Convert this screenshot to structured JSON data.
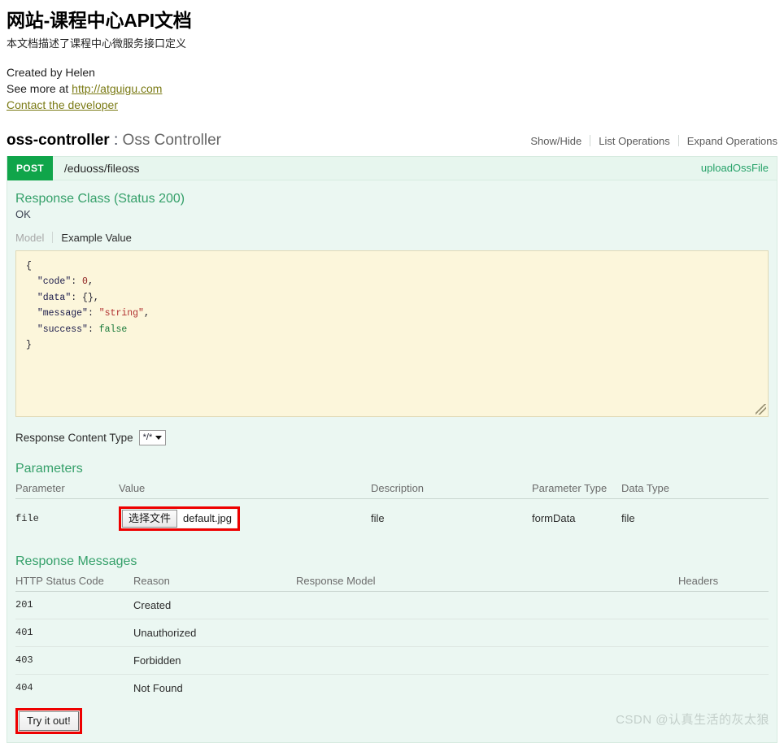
{
  "info": {
    "title": "网站-课程中心API文档",
    "description": "本文档描述了课程中心微服务接口定义",
    "created_by": "Created by Helen",
    "see_more_prefix": "See more at ",
    "see_more_link": "http://atguigu.com",
    "contact_link": "Contact the developer"
  },
  "resource": {
    "name": "oss-controller",
    "separator": " : ",
    "display_name": "Oss Controller",
    "actions": {
      "show_hide": "Show/Hide",
      "list_operations": "List Operations",
      "expand_operations": "Expand Operations"
    }
  },
  "operation": {
    "method": "POST",
    "path": "/eduoss/fileoss",
    "summary": "uploadOssFile",
    "response_class_title": "Response Class (Status 200)",
    "response_class_status": "OK",
    "tabs": {
      "model": "Model",
      "example_value": "Example Value"
    },
    "example_value": {
      "line_open": "{",
      "code_key": "\"code\"",
      "code_value": "0",
      "data_key": "\"data\"",
      "data_value": "{}",
      "message_key": "\"message\"",
      "message_value": "\"string\"",
      "success_key": "\"success\"",
      "success_value": "false",
      "line_close": "}"
    },
    "response_content_type_label": "Response Content Type",
    "response_content_type_value": "*/*"
  },
  "parameters": {
    "title": "Parameters",
    "headers": [
      "Parameter",
      "Value",
      "Description",
      "Parameter Type",
      "Data Type"
    ],
    "rows": [
      {
        "parameter": "file",
        "value_button": "选择文件",
        "value_filename": "default.jpg",
        "description": "file",
        "parameter_type": "formData",
        "data_type": "file"
      }
    ]
  },
  "response_messages": {
    "title": "Response Messages",
    "headers": [
      "HTTP Status Code",
      "Reason",
      "Response Model",
      "Headers"
    ],
    "rows": [
      {
        "code": "201",
        "reason": "Created",
        "model": "",
        "headers": ""
      },
      {
        "code": "401",
        "reason": "Unauthorized",
        "model": "",
        "headers": ""
      },
      {
        "code": "403",
        "reason": "Forbidden",
        "model": "",
        "headers": ""
      },
      {
        "code": "404",
        "reason": "Not Found",
        "model": "",
        "headers": ""
      }
    ]
  },
  "try_it_out_label": "Try it out!",
  "watermark": "CSDN @认真生活的灰太狼",
  "colors": {
    "method_post": "#10a54a",
    "accent_green": "#35a06a",
    "panel_bg": "#ebf7f2",
    "code_bg": "#fcf6db",
    "annotation_red": "#ee0000",
    "link_olive": "#7a7a14"
  }
}
